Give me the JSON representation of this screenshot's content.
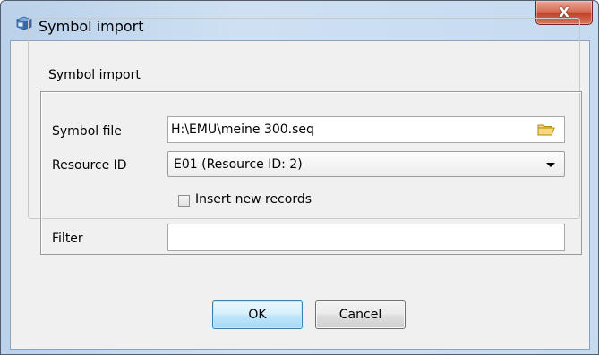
{
  "window": {
    "title": "Symbol import",
    "close_label": "X"
  },
  "group": {
    "title": "Symbol import"
  },
  "form": {
    "symbol_file_label": "Symbol file",
    "symbol_file_value": "H:\\EMU\\meine 300.seq",
    "resource_id_label": "Resource ID",
    "resource_id_selected": "E01 (Resource ID: 2)",
    "insert_new_records_label": "Insert new records",
    "insert_new_records_checked": false,
    "filter_label": "Filter",
    "filter_value": ""
  },
  "buttons": {
    "ok_label": "OK",
    "cancel_label": "Cancel"
  },
  "icons": {
    "app": "emu-app-icon",
    "browse": "folder-open-icon",
    "dropdown": "chevron-down-icon",
    "close": "close-icon"
  },
  "colors": {
    "titlebar": "#c6daf0",
    "close_button": "#c2432b",
    "dialog_background": "#f0f0f0",
    "default_button_border": "#3c7fb1"
  }
}
